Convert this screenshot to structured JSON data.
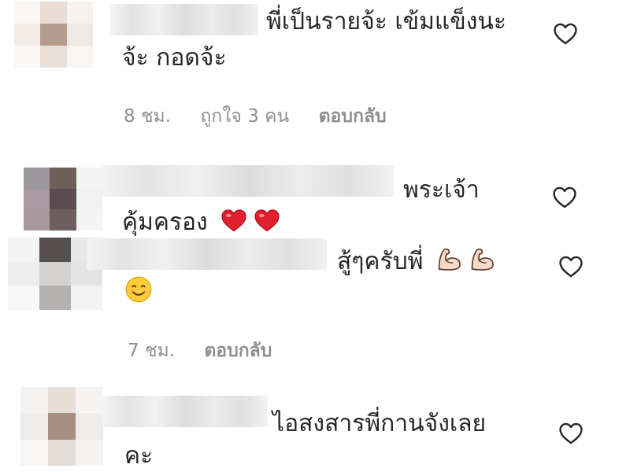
{
  "comments": [
    {
      "text_line1": "พี่เป็นรายจ้ะ เข้มแข็งนะ",
      "text_line2": "จ้ะ กอดจ้ะ",
      "time": "8 ชม.",
      "likes": "ถูกใจ 3 คน",
      "reply": "ตอบกลับ",
      "like_icon": "heart-outline-icon"
    },
    {
      "text_line1": "พระเจ้า",
      "text_line2": "คุ้มครอง",
      "emojis": [
        "red-heart-emoji",
        "red-heart-emoji"
      ],
      "like_icon": "heart-outline-icon"
    },
    {
      "text_line1": "สู้ๆครับพี่",
      "emojis": [
        "flexed-biceps-emoji",
        "flexed-biceps-emoji",
        "smiling-face-emoji"
      ],
      "time": "7 ชม.",
      "reply": "ตอบกลับ",
      "like_icon": "heart-outline-icon"
    },
    {
      "text_line1": "ไอสงสารพี่กานจังเลย",
      "text_line2": "คะ",
      "like_icon": "heart-outline-icon"
    }
  ]
}
